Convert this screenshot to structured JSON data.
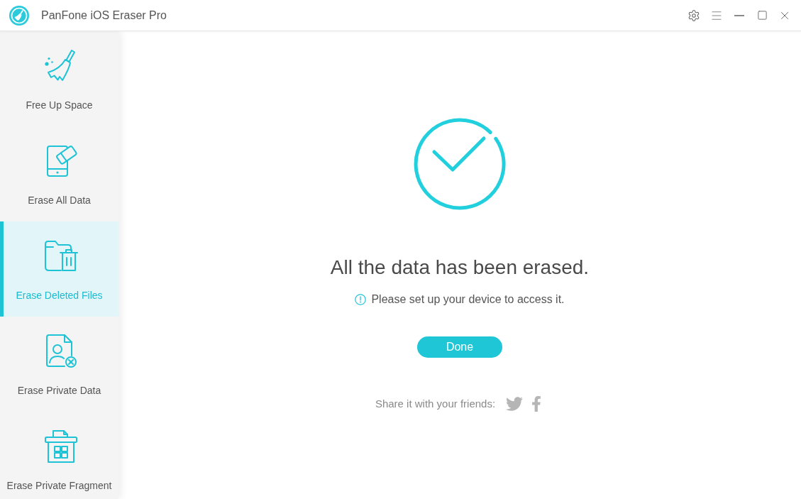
{
  "window": {
    "title": "PanFone iOS Eraser Pro"
  },
  "sidebar": {
    "items": [
      {
        "label": "Free Up Space",
        "selected": false
      },
      {
        "label": "Erase All Data",
        "selected": false
      },
      {
        "label": "Erase Deleted Files",
        "selected": true
      },
      {
        "label": "Erase Private Data",
        "selected": false
      },
      {
        "label": "Erase Private Fragment",
        "selected": false
      }
    ]
  },
  "result": {
    "title": "All the data has been erased.",
    "hint": "Please set up your device to access it.",
    "button": "Done",
    "share_label": "Share it with your friends:"
  }
}
